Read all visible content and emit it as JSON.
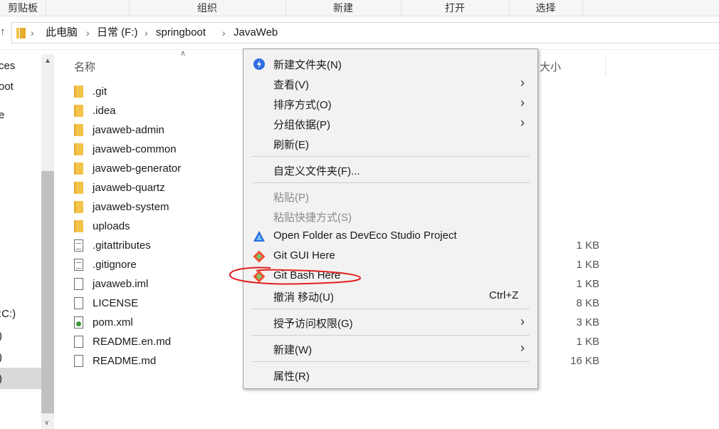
{
  "ribbon": {
    "groups": [
      "剪贴板",
      "组织",
      "新建",
      "打开",
      "选择"
    ]
  },
  "address": {
    "crumbs": [
      "此电脑",
      "日常 (F:)",
      "springboot",
      "JavaWeb"
    ]
  },
  "nav_pane": {
    "partial_items": [
      "ces",
      "oot",
      "e",
      ":C:)",
      ")",
      ")",
      ")"
    ]
  },
  "file_list": {
    "col_name": "名称",
    "col_size": "大小",
    "rows": [
      {
        "name": ".git",
        "type": "folder",
        "size": ""
      },
      {
        "name": ".idea",
        "type": "folder",
        "size": ""
      },
      {
        "name": "javaweb-admin",
        "type": "folder",
        "size": ""
      },
      {
        "name": "javaweb-common",
        "type": "folder",
        "size": ""
      },
      {
        "name": "javaweb-generator",
        "type": "folder",
        "size": ""
      },
      {
        "name": "javaweb-quartz",
        "type": "folder",
        "size": ""
      },
      {
        "name": "javaweb-system",
        "type": "folder",
        "size": ""
      },
      {
        "name": "uploads",
        "type": "folder",
        "size": ""
      },
      {
        "name": ".gitattributes",
        "type": "text-file",
        "size": "1 KB"
      },
      {
        "name": ".gitignore",
        "type": "text-file",
        "size": "1 KB"
      },
      {
        "name": "javaweb.iml",
        "type": "file",
        "size": "1 KB"
      },
      {
        "name": "LICENSE",
        "type": "file",
        "size": "8 KB"
      },
      {
        "name": "pom.xml",
        "type": "xml-file",
        "size": "3 KB"
      },
      {
        "name": "README.en.md",
        "type": "file",
        "size": "1 KB"
      },
      {
        "name": "README.md",
        "type": "file",
        "size": "16 KB"
      }
    ]
  },
  "context_menu": {
    "items": [
      {
        "label": "新建文件夹(N)",
        "icon": "new-folder-icon"
      },
      {
        "label": "查看(V)",
        "submenu": true
      },
      {
        "label": "排序方式(O)",
        "submenu": true
      },
      {
        "label": "分组依据(P)",
        "submenu": true
      },
      {
        "label": "刷新(E)"
      },
      {
        "label": "自定义文件夹(F)..."
      },
      {
        "label": "粘贴(P)",
        "disabled": true
      },
      {
        "label": "粘贴快捷方式(S)",
        "disabled": true
      },
      {
        "label": "Open Folder as DevEco Studio Project",
        "icon": "deveco-icon"
      },
      {
        "label": "Git GUI Here",
        "icon": "git-icon"
      },
      {
        "label": "Git Bash Here",
        "icon": "git-icon"
      },
      {
        "label": "撤消 移动(U)",
        "shortcut": "Ctrl+Z"
      },
      {
        "label": "授予访问权限(G)",
        "submenu": true
      },
      {
        "label": "新建(W)",
        "submenu": true
      },
      {
        "label": "属性(R)"
      }
    ]
  },
  "colors": {
    "folder": "#f4c34a",
    "annotation": "#e02020",
    "deveco_blue": "#2f6de1",
    "git_orange": "#f05033"
  }
}
